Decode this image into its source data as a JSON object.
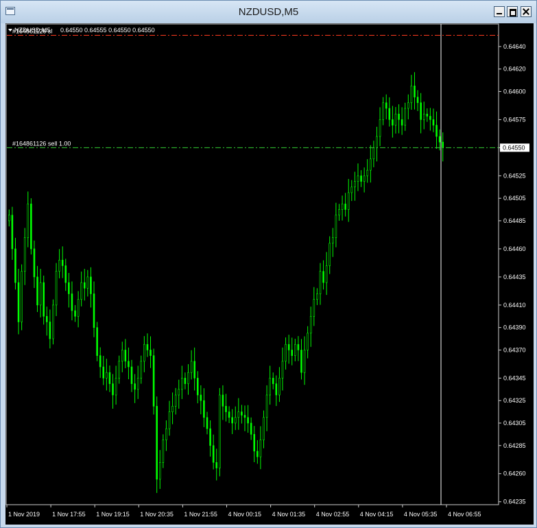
{
  "window": {
    "title": "NZDUSD,M5"
  },
  "chart_header": {
    "symbol": "NZDUSD,M5",
    "ohlc": "0.64550 0.64555 0.64550 0.64550"
  },
  "lines": {
    "sl_label": "#164861126 sl",
    "order_label": "#164861126 sell 1.00",
    "price_marker": "0.64550"
  },
  "chart_data": {
    "type": "candlestick",
    "y_ticks": [
      "0.64640",
      "0.64620",
      "0.64600",
      "0.64575",
      "0.64550",
      "0.64525",
      "0.64505",
      "0.64485",
      "0.64460",
      "0.64435",
      "0.64410",
      "0.64390",
      "0.64370",
      "0.64345",
      "0.64325",
      "0.64305",
      "0.64285",
      "0.64260",
      "0.64235"
    ],
    "x_ticks": [
      "1 Nov 2019",
      "1 Nov 17:55",
      "1 Nov 19:15",
      "1 Nov 20:35",
      "1 Nov 21:55",
      "4 Nov 00:15",
      "4 Nov 01:35",
      "4 Nov 02:55",
      "4 Nov 04:15",
      "4 Nov 05:35",
      "4 Nov 06:55"
    ],
    "ylim": [
      0.64233,
      0.64657
    ],
    "sl_price": 0.6465,
    "order_price": 0.6455,
    "current_price": 0.6455,
    "colors": {
      "up": "#00ff00",
      "down": "#00ff00",
      "sl_line": "#ff3b1f",
      "order_line": "#33cc33",
      "cursor": "#ffffff"
    },
    "closes": [
      0.6449,
      0.6446,
      0.6443,
      0.64395,
      0.6444,
      0.6447,
      0.645,
      0.6446,
      0.64435,
      0.6441,
      0.6443,
      0.644,
      0.64395,
      0.6438,
      0.6441,
      0.6444,
      0.6445,
      0.64445,
      0.6443,
      0.6442,
      0.64405,
      0.644,
      0.64415,
      0.6443,
      0.64425,
      0.64435,
      0.6442,
      0.6439,
      0.64365,
      0.64355,
      0.64345,
      0.6435,
      0.6434,
      0.6433,
      0.64345,
      0.6436,
      0.6437,
      0.6436,
      0.64355,
      0.6434,
      0.64335,
      0.64345,
      0.6436,
      0.64375,
      0.6437,
      0.64365,
      0.6432,
      0.64255,
      0.6427,
      0.6429,
      0.643,
      0.64315,
      0.6432,
      0.6433,
      0.64335,
      0.64345,
      0.6434,
      0.6435,
      0.6436,
      0.64345,
      0.6433,
      0.64325,
      0.6431,
      0.643,
      0.64285,
      0.6427,
      0.64265,
      0.6433,
      0.6432,
      0.64315,
      0.6431,
      0.64305,
      0.6431,
      0.64315,
      0.64312,
      0.6431,
      0.64305,
      0.64295,
      0.6428,
      0.64275,
      0.6429,
      0.6431,
      0.6433,
      0.64345,
      0.6434,
      0.6433,
      0.64345,
      0.6436,
      0.64375,
      0.6437,
      0.64365,
      0.64375,
      0.6437,
      0.6435,
      0.6437,
      0.64385,
      0.644,
      0.64415,
      0.6442,
      0.6444,
      0.6443,
      0.64445,
      0.64465,
      0.6447,
      0.6449,
      0.64495,
      0.645,
      0.64495,
      0.6451,
      0.64515,
      0.6452,
      0.64525,
      0.6452,
      0.64525,
      0.6453,
      0.6454,
      0.6455,
      0.6456,
      0.64575,
      0.6459,
      0.64585,
      0.64575,
      0.6457,
      0.6458,
      0.64575,
      0.6457,
      0.64585,
      0.6459,
      0.64605,
      0.64595,
      0.6459,
      0.64575,
      0.6458,
      0.64578,
      0.64575,
      0.6457,
      0.6456,
      0.64555,
      0.6455
    ]
  }
}
